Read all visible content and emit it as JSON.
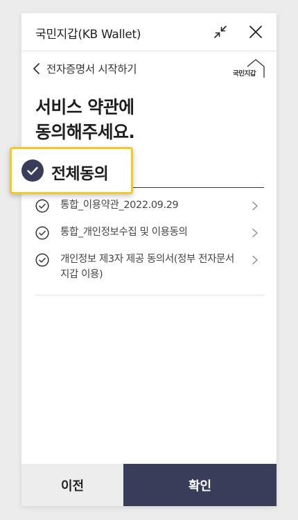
{
  "app": {
    "title": "국민지갑(KB Wallet)"
  },
  "titlebar": {
    "minimize_icon": "collapse-arrows-icon",
    "close_icon": "close-icon"
  },
  "nav": {
    "back_label": "전자증명서 시작하기",
    "logo_text": "국민지갑"
  },
  "headline": {
    "line1": "서비스 약관에",
    "line2": "동의해주세요."
  },
  "agree_all": {
    "label": "전체동의",
    "checked": true
  },
  "terms": [
    {
      "label": "통합_이용약관_2022.09.29",
      "checked": true
    },
    {
      "label": "통합_개인정보수집 및 이용동의",
      "checked": true
    },
    {
      "label": "개인정보 제3자 제공 동의서(정부 전자문서지갑 이용)",
      "checked": true
    }
  ],
  "footer": {
    "prev_label": "이전",
    "confirm_label": "확인"
  },
  "colors": {
    "highlight": "#f6c823",
    "primary": "#393d5a",
    "check_fill": "#393d5a",
    "background": "#ececec"
  }
}
